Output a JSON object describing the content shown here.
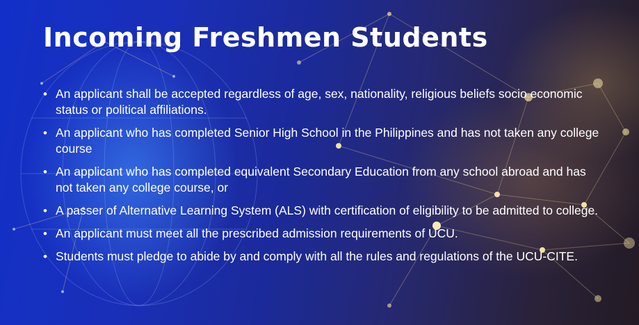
{
  "slide": {
    "title": "Incoming Freshmen Students",
    "bullets": [
      "An applicant shall be accepted regardless of age, sex, nationality, religious beliefs socio economic status or political affiliations.",
      "An applicant who has completed Senior High School in the Philippines and has not taken any college course",
      "An applicant who has completed equivalent Secondary Education from any school abroad and has not taken any college course, or",
      "A passer of Alternative Learning System (ALS) with certification of eligibility to be admitted to college.",
      "An applicant must meet all the prescribed admission requirements of UCU.",
      "Students must pledge to abide by and comply with all the rules and regulations of the UCU-CITE."
    ],
    "bullet_marker": "•"
  },
  "colors": {
    "text": "#ffffff",
    "background_left": "#1230c8",
    "background_right": "#231a24",
    "node_glow": "#f3e2a6"
  }
}
